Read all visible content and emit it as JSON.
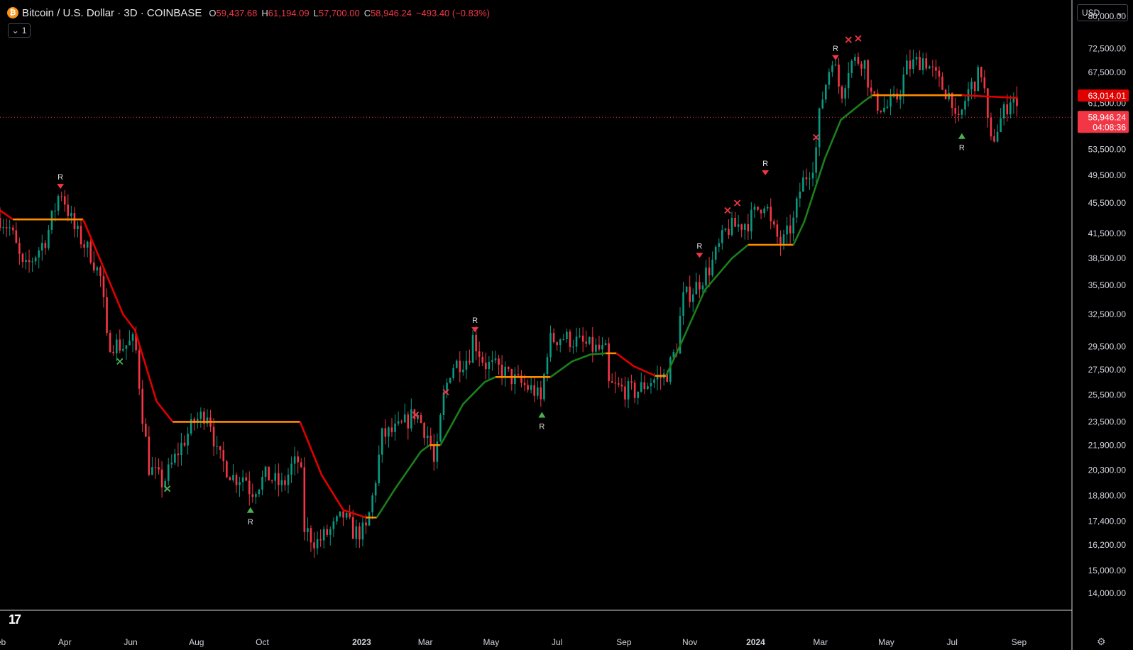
{
  "header": {
    "logo_letter": "₿",
    "title": "Bitcoin / U.S. Dollar · 3D · COINBASE",
    "open_k": "O",
    "open_v": "59,437.68",
    "high_k": "H",
    "high_v": "61,194.09",
    "low_k": "L",
    "low_v": "57,700.00",
    "close_k": "C",
    "close_v": "58,946.24",
    "change": "−493.40 (−0.83%)"
  },
  "interval_button": {
    "chevron": "⌄",
    "label": "1"
  },
  "currency_select": {
    "value": "USD",
    "chevron": "⌄"
  },
  "colors": {
    "up": "#089981",
    "down": "#f23645",
    "bg": "#000000",
    "axis": "#d1d4dc",
    "line_up": "#1b7f1b",
    "line_down": "#e00000",
    "line_flat": "#ff8c00",
    "marker_green": "#4caf50"
  },
  "chart_data": {
    "type": "candlestick",
    "y_scale": "log",
    "ylim": [
      13300,
      84000
    ],
    "y_ticks": [
      "80,000.00",
      "72,500.00",
      "67,500.00",
      "61,500.00",
      "53,500.00",
      "49,500.00",
      "45,500.00",
      "41,500.00",
      "38,500.00",
      "35,500.00",
      "32,500.00",
      "29,500.00",
      "27,500.00",
      "25,500.00",
      "23,500.00",
      "21,900.00",
      "20,300.00",
      "18,800.00",
      "17,400.00",
      "16,200.00",
      "15,000.00",
      "14,000.00"
    ],
    "y_tick_values": [
      80000,
      72500,
      67500,
      61500,
      53500,
      49500,
      45500,
      41500,
      38500,
      35500,
      32500,
      29500,
      27500,
      25500,
      23500,
      21900,
      20300,
      18800,
      17400,
      16200,
      15000,
      14000
    ],
    "x_ticks": [
      {
        "label": "eb",
        "date": "2022-02-01",
        "bold": false
      },
      {
        "label": "Apr",
        "date": "2022-04-01",
        "bold": false
      },
      {
        "label": "Jun",
        "date": "2022-06-01",
        "bold": false
      },
      {
        "label": "Aug",
        "date": "2022-08-01",
        "bold": false
      },
      {
        "label": "Oct",
        "date": "2022-10-01",
        "bold": false
      },
      {
        "label": "2023",
        "date": "2023-01-01",
        "bold": true
      },
      {
        "label": "Mar",
        "date": "2023-03-01",
        "bold": false
      },
      {
        "label": "May",
        "date": "2023-05-01",
        "bold": false
      },
      {
        "label": "Jul",
        "date": "2023-07-01",
        "bold": false
      },
      {
        "label": "Sep",
        "date": "2023-09-01",
        "bold": false
      },
      {
        "label": "Nov",
        "date": "2023-11-01",
        "bold": false
      },
      {
        "label": "2024",
        "date": "2024-01-01",
        "bold": true
      },
      {
        "label": "Mar",
        "date": "2024-03-01",
        "bold": false
      },
      {
        "label": "May",
        "date": "2024-05-01",
        "bold": false
      },
      {
        "label": "Jul",
        "date": "2024-07-01",
        "bold": false
      },
      {
        "label": "Sep",
        "date": "2024-09-01",
        "bold": false
      }
    ],
    "xlim": [
      "2022-01-31",
      "2024-10-20"
    ],
    "price_path": [
      [
        "2022-01-31",
        43500
      ],
      [
        "2022-02-10",
        42000
      ],
      [
        "2022-02-22",
        37000
      ],
      [
        "2022-03-05",
        39000
      ],
      [
        "2022-03-15",
        41000
      ],
      [
        "2022-03-28",
        47500
      ],
      [
        "2022-04-10",
        42000
      ],
      [
        "2022-04-25",
        39000
      ],
      [
        "2022-05-05",
        36000
      ],
      [
        "2022-05-10",
        30000
      ],
      [
        "2022-05-25",
        29500
      ],
      [
        "2022-06-05",
        30000
      ],
      [
        "2022-06-12",
        24000
      ],
      [
        "2022-06-18",
        20500
      ],
      [
        "2022-07-01",
        19500
      ],
      [
        "2022-07-15",
        21500
      ],
      [
        "2022-07-30",
        23500
      ],
      [
        "2022-08-12",
        24300
      ],
      [
        "2022-08-20",
        21300
      ],
      [
        "2022-09-05",
        19800
      ],
      [
        "2022-09-15",
        20000
      ],
      [
        "2022-09-20",
        19000
      ],
      [
        "2022-10-05",
        20000
      ],
      [
        "2022-10-20",
        19300
      ],
      [
        "2022-10-28",
        20500
      ],
      [
        "2022-11-05",
        21000
      ],
      [
        "2022-11-09",
        17000
      ],
      [
        "2022-11-20",
        16300
      ],
      [
        "2022-12-05",
        17000
      ],
      [
        "2022-12-15",
        17700
      ],
      [
        "2022-12-25",
        16800
      ],
      [
        "2023-01-05",
        16900
      ],
      [
        "2023-01-12",
        19000
      ],
      [
        "2023-01-20",
        22500
      ],
      [
        "2023-02-05",
        23000
      ],
      [
        "2023-02-20",
        24200
      ],
      [
        "2023-03-05",
        22300
      ],
      [
        "2023-03-10",
        20300
      ],
      [
        "2023-03-17",
        25000
      ],
      [
        "2023-03-25",
        27800
      ],
      [
        "2023-04-10",
        28500
      ],
      [
        "2023-04-14",
        30300
      ],
      [
        "2023-04-25",
        28000
      ],
      [
        "2023-05-10",
        27500
      ],
      [
        "2023-05-25",
        26500
      ],
      [
        "2023-06-10",
        25800
      ],
      [
        "2023-06-16",
        25000
      ],
      [
        "2023-06-23",
        30000
      ],
      [
        "2023-07-05",
        30400
      ],
      [
        "2023-07-20",
        29900
      ],
      [
        "2023-08-05",
        29300
      ],
      [
        "2023-08-15",
        29000
      ],
      [
        "2023-08-18",
        26200
      ],
      [
        "2023-09-01",
        25900
      ],
      [
        "2023-09-12",
        25700
      ],
      [
        "2023-09-25",
        26600
      ],
      [
        "2023-10-10",
        27000
      ],
      [
        "2023-10-20",
        29500
      ],
      [
        "2023-10-25",
        34000
      ],
      [
        "2023-11-05",
        35100
      ],
      [
        "2023-11-20",
        37500
      ],
      [
        "2023-12-05",
        42000
      ],
      [
        "2023-12-15",
        42500
      ],
      [
        "2023-12-25",
        43000
      ],
      [
        "2024-01-10",
        46000
      ],
      [
        "2024-01-15",
        42500
      ],
      [
        "2024-01-25",
        40000
      ],
      [
        "2024-02-05",
        43000
      ],
      [
        "2024-02-12",
        48000
      ],
      [
        "2024-02-25",
        52000
      ],
      [
        "2024-03-01",
        61000
      ],
      [
        "2024-03-12",
        71000
      ],
      [
        "2024-03-20",
        63000
      ],
      [
        "2024-03-28",
        69500
      ],
      [
        "2024-04-10",
        70500
      ],
      [
        "2024-04-18",
        62000
      ],
      [
        "2024-04-30",
        60500
      ],
      [
        "2024-05-10",
        62000
      ],
      [
        "2024-05-20",
        68500
      ],
      [
        "2024-06-05",
        70500
      ],
      [
        "2024-06-20",
        65000
      ],
      [
        "2024-07-01",
        62500
      ],
      [
        "2024-07-05",
        56500
      ],
      [
        "2024-07-15",
        63500
      ],
      [
        "2024-07-29",
        68000
      ],
      [
        "2024-08-05",
        54000
      ],
      [
        "2024-08-15",
        58500
      ],
      [
        "2024-08-26",
        63500
      ],
      [
        "2024-08-31",
        58946.24
      ]
    ],
    "trail_line": [
      {
        "seg": "down",
        "pts": [
          [
            "2022-01-31",
            44500
          ],
          [
            "2022-02-12",
            43300
          ]
        ]
      },
      {
        "seg": "flat",
        "pts": [
          [
            "2022-02-12",
            43300
          ],
          [
            "2022-04-18",
            43300
          ]
        ]
      },
      {
        "seg": "down",
        "pts": [
          [
            "2022-04-18",
            43300
          ],
          [
            "2022-05-05",
            38000
          ],
          [
            "2022-05-25",
            32500
          ],
          [
            "2022-06-05",
            31000
          ],
          [
            "2022-06-25",
            25000
          ],
          [
            "2022-07-10",
            23500
          ]
        ]
      },
      {
        "seg": "flat",
        "pts": [
          [
            "2022-07-10",
            23500
          ],
          [
            "2022-11-05",
            23500
          ]
        ]
      },
      {
        "seg": "down",
        "pts": [
          [
            "2022-11-05",
            23500
          ],
          [
            "2022-11-25",
            20000
          ],
          [
            "2022-12-15",
            18000
          ],
          [
            "2023-01-05",
            17600
          ]
        ]
      },
      {
        "seg": "flat",
        "pts": [
          [
            "2023-01-05",
            17600
          ],
          [
            "2023-01-15",
            17600
          ]
        ]
      },
      {
        "seg": "up",
        "pts": [
          [
            "2023-01-15",
            17600
          ],
          [
            "2023-02-01",
            19200
          ],
          [
            "2023-02-25",
            21500
          ],
          [
            "2023-03-05",
            21900
          ]
        ]
      },
      {
        "seg": "flat",
        "pts": [
          [
            "2023-03-05",
            21900
          ],
          [
            "2023-03-15",
            21900
          ]
        ]
      },
      {
        "seg": "up",
        "pts": [
          [
            "2023-03-15",
            21900
          ],
          [
            "2023-04-05",
            24800
          ],
          [
            "2023-04-25",
            26500
          ],
          [
            "2023-05-05",
            26900
          ]
        ]
      },
      {
        "seg": "flat",
        "pts": [
          [
            "2023-05-05",
            26900
          ],
          [
            "2023-06-25",
            26900
          ]
        ]
      },
      {
        "seg": "up",
        "pts": [
          [
            "2023-06-25",
            26900
          ],
          [
            "2023-07-15",
            28200
          ],
          [
            "2023-08-01",
            28800
          ],
          [
            "2023-08-15",
            28900
          ]
        ]
      },
      {
        "seg": "flat",
        "pts": [
          [
            "2023-08-15",
            28900
          ],
          [
            "2023-08-25",
            28900
          ]
        ]
      },
      {
        "seg": "down",
        "pts": [
          [
            "2023-08-25",
            28900
          ],
          [
            "2023-09-10",
            27800
          ],
          [
            "2023-09-30",
            27000
          ]
        ]
      },
      {
        "seg": "flat",
        "pts": [
          [
            "2023-09-30",
            27000
          ],
          [
            "2023-10-10",
            27000
          ]
        ]
      },
      {
        "seg": "up",
        "pts": [
          [
            "2023-10-10",
            27000
          ],
          [
            "2023-10-25",
            30000
          ],
          [
            "2023-11-15",
            35000
          ],
          [
            "2023-12-10",
            38500
          ],
          [
            "2023-12-25",
            40100
          ]
        ]
      },
      {
        "seg": "flat",
        "pts": [
          [
            "2023-12-25",
            40100
          ],
          [
            "2024-02-05",
            40100
          ]
        ]
      },
      {
        "seg": "up",
        "pts": [
          [
            "2024-02-05",
            40100
          ],
          [
            "2024-02-15",
            43000
          ],
          [
            "2024-03-05",
            52000
          ],
          [
            "2024-03-20",
            58500
          ],
          [
            "2024-04-10",
            61800
          ],
          [
            "2024-04-18",
            63000
          ]
        ]
      },
      {
        "seg": "flat",
        "pts": [
          [
            "2024-04-18",
            63000
          ],
          [
            "2024-07-10",
            63000
          ]
        ]
      },
      {
        "seg": "down",
        "pts": [
          [
            "2024-07-10",
            63000
          ],
          [
            "2024-08-31",
            62500
          ]
        ]
      }
    ],
    "markers": [
      {
        "kind": "tri-down",
        "date": "2022-03-28",
        "price": 47800,
        "label": "R",
        "color": "red"
      },
      {
        "kind": "cross",
        "date": "2022-05-22",
        "price": 28200,
        "color": "green"
      },
      {
        "kind": "cross",
        "date": "2022-07-05",
        "price": 19200,
        "color": "green"
      },
      {
        "kind": "tri-up",
        "date": "2022-09-20",
        "price": 18000,
        "label": "R",
        "color": "green"
      },
      {
        "kind": "cross",
        "date": "2023-02-20",
        "price": 24000,
        "color": "red"
      },
      {
        "kind": "cross",
        "date": "2023-03-20",
        "price": 25700,
        "color": "red"
      },
      {
        "kind": "tri-down",
        "date": "2023-04-16",
        "price": 31000,
        "label": "R",
        "color": "red"
      },
      {
        "kind": "tri-up",
        "date": "2023-06-17",
        "price": 24000,
        "label": "R",
        "color": "green"
      },
      {
        "kind": "tri-down",
        "date": "2023-11-10",
        "price": 38800,
        "label": "R",
        "color": "red"
      },
      {
        "kind": "cross",
        "date": "2023-12-06",
        "price": 44500,
        "color": "red"
      },
      {
        "kind": "cross",
        "date": "2023-12-15",
        "price": 45500,
        "color": "red"
      },
      {
        "kind": "tri-down",
        "date": "2024-01-10",
        "price": 49800,
        "label": "R",
        "color": "red"
      },
      {
        "kind": "cross",
        "date": "2024-02-26",
        "price": 55500,
        "color": "red"
      },
      {
        "kind": "tri-down",
        "date": "2024-03-15",
        "price": 70500,
        "label": "R",
        "color": "red"
      },
      {
        "kind": "cross",
        "date": "2024-03-27",
        "price": 74500,
        "color": "red"
      },
      {
        "kind": "cross",
        "date": "2024-04-05",
        "price": 74800,
        "color": "red"
      },
      {
        "kind": "tri-up",
        "date": "2024-07-10",
        "price": 55700,
        "label": "R",
        "color": "green"
      }
    ],
    "price_line": {
      "value": 58946.24,
      "label": "58,946.24",
      "countdown": "04:08:36"
    },
    "trail_label": {
      "value": 63014.01,
      "label": "63,014.01"
    }
  }
}
